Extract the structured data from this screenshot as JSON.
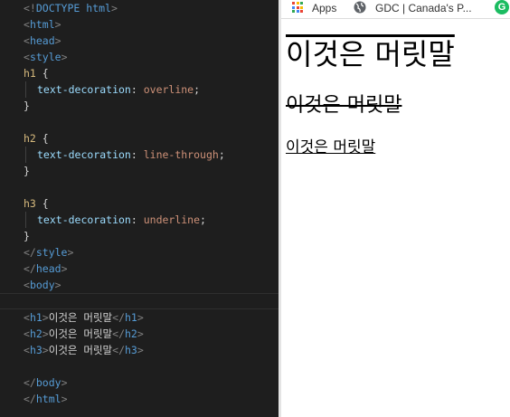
{
  "editor": {
    "lines": [
      {
        "open": "<!",
        "name": "DOCTYPE",
        "rest": " html",
        "close": ">"
      },
      {
        "tag": "html"
      },
      {
        "tag": "head"
      },
      {
        "tag": "style"
      },
      {
        "selector": "h1",
        "brace": " {"
      },
      {
        "prop": "text-decoration",
        "value": "overline"
      },
      {
        "close_brace": "}"
      },
      {
        "selector": "h2",
        "brace": " {"
      },
      {
        "prop": "text-decoration",
        "value": "line-through"
      },
      {
        "close_brace": "}"
      },
      {
        "selector": "h3",
        "brace": " {"
      },
      {
        "prop": "text-decoration",
        "value": "underline"
      },
      {
        "close_brace": "}"
      },
      {
        "endtag": "style"
      },
      {
        "endtag": "head"
      },
      {
        "tag": "body"
      },
      {
        "h": "h1",
        "text": "이것은 머릿말"
      },
      {
        "h": "h2",
        "text": "이것은 머릿말"
      },
      {
        "h": "h3",
        "text": "이것은 머릿말"
      },
      {
        "endtag": "body"
      },
      {
        "endtag": "html"
      }
    ]
  },
  "bookmarks": {
    "apps_label": "Apps",
    "gdc_label": "GDC | Canada's P...",
    "extension_letter": "G"
  },
  "page": {
    "h1": "이것은 머릿말",
    "h2": "이것은 머릿말",
    "h3": "이것은 머릿말"
  }
}
